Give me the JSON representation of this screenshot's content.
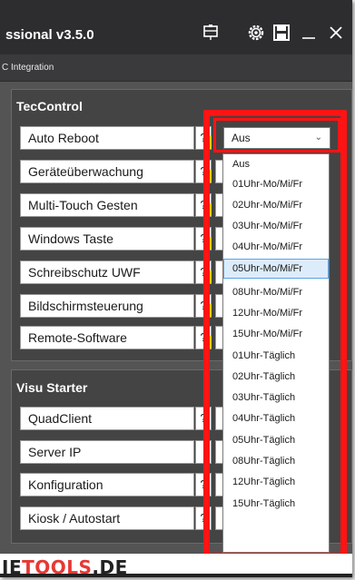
{
  "window": {
    "title": "ssional v3.5.0",
    "subtitle": "C Integration"
  },
  "tec_control": {
    "title": "TecControl",
    "rows": [
      {
        "label": "Auto Reboot",
        "help": "?"
      },
      {
        "label": "Geräteüberwachung",
        "help": "?"
      },
      {
        "label": "Multi-Touch Gesten",
        "help": "?"
      },
      {
        "label": "Windows Taste",
        "help": "?"
      },
      {
        "label": "Schreibschutz UWF",
        "help": "?"
      },
      {
        "label": "Bildschirmsteuerung",
        "help": "?"
      },
      {
        "label": "Remote-Software",
        "help": "?"
      }
    ]
  },
  "visu_starter": {
    "title": "Visu Starter",
    "rows": [
      {
        "label": "QuadClient",
        "help": "?"
      },
      {
        "label": "Server IP",
        "help": ""
      },
      {
        "label": "Konfiguration",
        "help": "?"
      },
      {
        "label": "Kiosk / Autostart",
        "help": "?"
      }
    ]
  },
  "auto_reboot_select": {
    "value": "Aus",
    "options": [
      "Aus",
      "01Uhr-Mo/Mi/Fr",
      "02Uhr-Mo/Mi/Fr",
      "03Uhr-Mo/Mi/Fr",
      "04Uhr-Mo/Mi/Fr",
      "05Uhr-Mo/Mi/Fr",
      "08Uhr-Mo/Mi/Fr",
      "12Uhr-Mo/Mi/Fr",
      "15Uhr-Mo/Mi/Fr",
      "01Uhr-Täglich",
      "02Uhr-Täglich",
      "03Uhr-Täglich",
      "04Uhr-Täglich",
      "05Uhr-Täglich",
      "08Uhr-Täglich",
      "12Uhr-Täglich",
      "15Uhr-Täglich"
    ],
    "highlighted": "05Uhr-Mo/Mi/Fr"
  },
  "footer": {
    "brand_part1": "IE",
    "brand_part2": "TOOLS",
    "brand_part3": ".DE"
  },
  "colors": {
    "highlight": "#ff1414",
    "help_strip": "#ffd200",
    "selected_bg": "#dcecfb"
  },
  "icons": [
    "network-icon",
    "settings-icon",
    "save-icon",
    "minimize-icon",
    "close-icon",
    "chevron-down-icon"
  ]
}
